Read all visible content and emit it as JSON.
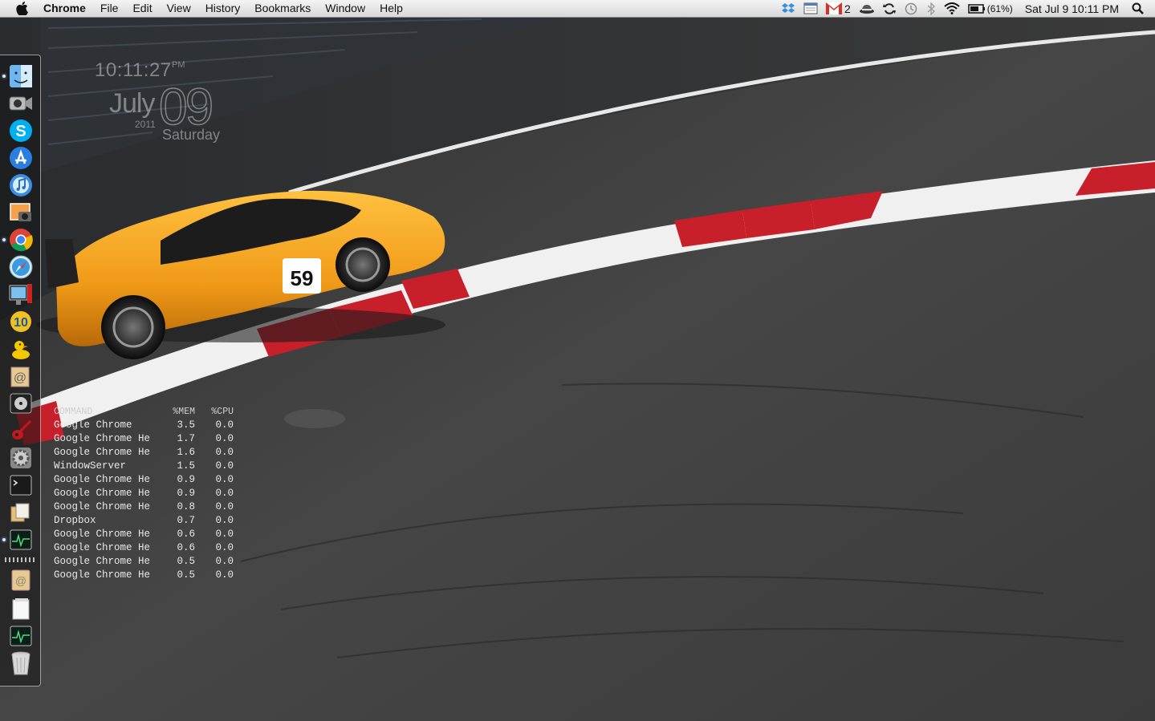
{
  "menubar": {
    "app_name": "Chrome",
    "menus": [
      "File",
      "Edit",
      "View",
      "History",
      "Bookmarks",
      "Window",
      "Help"
    ],
    "gmail_unread": "2",
    "battery_percent": "(61%)",
    "datetime": "Sat Jul 9  10:11 PM",
    "status_icons": [
      "dropbox-icon",
      "calendar-icon",
      "gmail-icon",
      "hat-icon",
      "sync-icon",
      "time-machine-icon",
      "bluetooth-icon",
      "wifi-icon",
      "battery-icon",
      "spotlight-icon"
    ]
  },
  "clock_widget": {
    "time": "10:11:27",
    "ampm": "PM",
    "month": "July",
    "day": "09",
    "year": "2011",
    "weekday": "Saturday"
  },
  "process_monitor": {
    "headers": [
      "COMMAND",
      "%MEM",
      "%CPU"
    ],
    "rows": [
      {
        "command": "Google Chrome",
        "mem": "3.5",
        "cpu": "0.0"
      },
      {
        "command": "Google Chrome He",
        "mem": "1.7",
        "cpu": "0.0"
      },
      {
        "command": "Google Chrome He",
        "mem": "1.6",
        "cpu": "0.0"
      },
      {
        "command": "WindowServer",
        "mem": "1.5",
        "cpu": "0.0"
      },
      {
        "command": "Google Chrome He",
        "mem": "0.9",
        "cpu": "0.0"
      },
      {
        "command": "Google Chrome He",
        "mem": "0.9",
        "cpu": "0.0"
      },
      {
        "command": "Google Chrome He",
        "mem": "0.8",
        "cpu": "0.0"
      },
      {
        "command": "Dropbox",
        "mem": "0.7",
        "cpu": "0.0"
      },
      {
        "command": "Google Chrome He",
        "mem": "0.6",
        "cpu": "0.0"
      },
      {
        "command": "Google Chrome He",
        "mem": "0.6",
        "cpu": "0.0"
      },
      {
        "command": "Google Chrome He",
        "mem": "0.5",
        "cpu": "0.0"
      },
      {
        "command": "Google Chrome He",
        "mem": "0.5",
        "cpu": "0.0"
      }
    ]
  },
  "wallpaper": {
    "car_number": "59"
  },
  "dock": {
    "apps": [
      {
        "icon": "finder-icon",
        "running": true
      },
      {
        "icon": "facetime-icon",
        "running": false
      },
      {
        "icon": "skype-icon",
        "running": false
      },
      {
        "icon": "app-store-icon",
        "running": false
      },
      {
        "icon": "itunes-icon",
        "running": false
      },
      {
        "icon": "iphoto-icon",
        "running": false
      },
      {
        "icon": "chrome-icon",
        "running": true
      },
      {
        "icon": "safari-icon",
        "running": false
      },
      {
        "icon": "photo-booth-icon",
        "running": false
      },
      {
        "icon": "ten-icon",
        "running": false
      },
      {
        "icon": "cyberduck-icon",
        "running": false
      },
      {
        "icon": "mail-icon",
        "running": false
      },
      {
        "icon": "dvd-player-icon",
        "running": false
      },
      {
        "icon": "guitar-icon",
        "running": false
      },
      {
        "icon": "system-preferences-icon",
        "running": false
      },
      {
        "icon": "terminal-icon",
        "running": false
      },
      {
        "icon": "preview-icon",
        "running": false
      },
      {
        "icon": "activity-monitor-icon",
        "running": true
      }
    ],
    "stacks": [
      "downloads-stack-icon",
      "documents-stack-icon",
      "activity-stack-icon",
      "trash-icon"
    ]
  },
  "colors": {
    "track": "#3c3c3c",
    "kerb_red": "#c8202a",
    "car_orange": "#f0a020",
    "menubar": "#e6e6e6"
  }
}
